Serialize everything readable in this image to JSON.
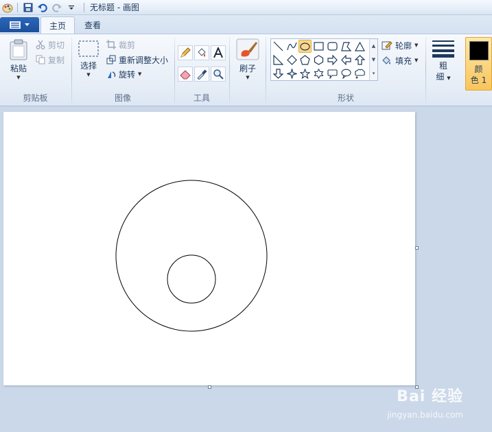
{
  "window": {
    "title": "无标题 - 画图"
  },
  "tabs": [
    {
      "label": "主页",
      "active": true
    },
    {
      "label": "查看",
      "active": false
    }
  ],
  "clipboard": {
    "paste_label": "粘贴",
    "cut_label": "剪切",
    "copy_label": "复制",
    "group_label": "剪贴板"
  },
  "image": {
    "select_label": "选择",
    "crop_label": "裁剪",
    "resize_label": "重新调整大小",
    "rotate_label": "旋转",
    "group_label": "图像"
  },
  "tools": {
    "group_label": "工具"
  },
  "brushes": {
    "label": "刷子"
  },
  "shapes": {
    "outline_label": "轮廓",
    "fill_label": "填充",
    "group_label": "形状",
    "selected": "oval"
  },
  "size": {
    "label_line1": "粗",
    "label_line2": "细"
  },
  "color1": {
    "label_line1": "颜",
    "label_line2": "色 1",
    "value": "#000000"
  },
  "watermark": {
    "text": "Bai 经验",
    "sub": "jingyan.baidu.com"
  }
}
